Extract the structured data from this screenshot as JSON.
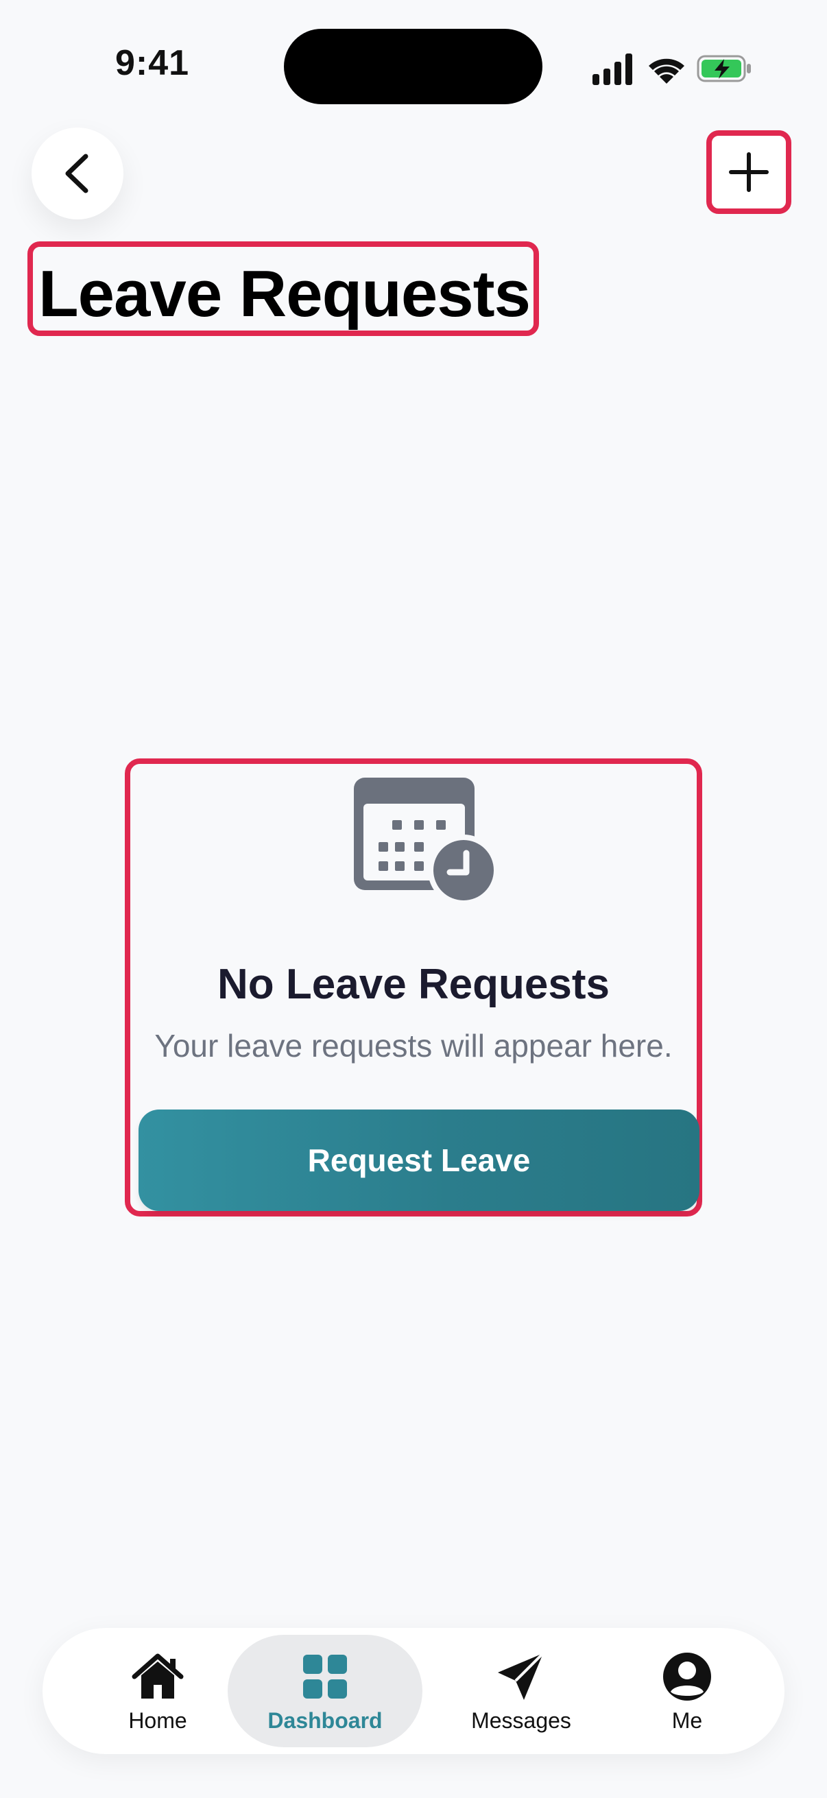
{
  "status_bar": {
    "time": "9:41",
    "icons": [
      "cellular-signal-icon",
      "wifi-icon",
      "battery-charging-icon"
    ],
    "battery_color": "#34c759"
  },
  "header": {
    "back_icon": "chevron-left-icon",
    "add_icon": "plus-icon",
    "title": "Leave Requests"
  },
  "empty_state": {
    "icon": "calendar-clock-icon",
    "title": "No Leave Requests",
    "subtitle": "Your leave requests will appear here.",
    "button_label": "Request Leave"
  },
  "tab_bar": {
    "tabs": [
      {
        "label": "Home",
        "icon": "home-icon",
        "active": false
      },
      {
        "label": "Dashboard",
        "icon": "dashboard-grid-icon",
        "active": true
      },
      {
        "label": "Messages",
        "icon": "paper-plane-icon",
        "active": false
      },
      {
        "label": "Me",
        "icon": "user-avatar-icon",
        "active": false
      }
    ]
  },
  "colors": {
    "accent": "#2e8797",
    "highlight_border": "#e0284f",
    "background": "#f8f9fb",
    "icon_gray": "#6b717d"
  }
}
